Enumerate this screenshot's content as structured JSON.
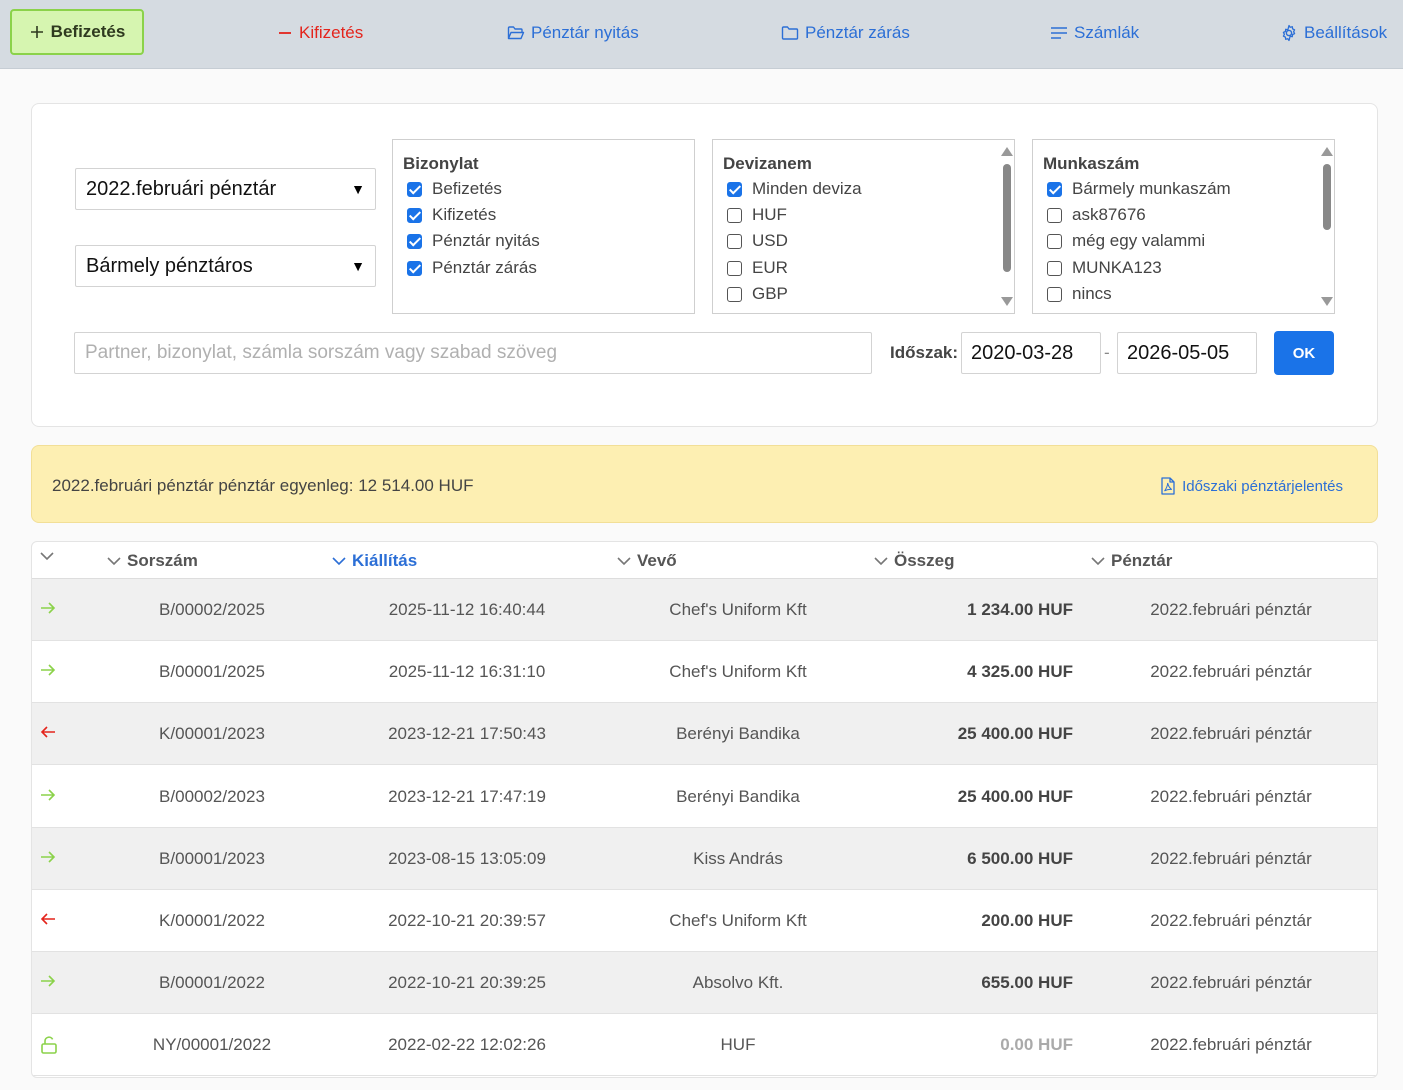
{
  "nav": {
    "deposit": "Befizetés",
    "withdrawal": "Kifizetés",
    "open_register": "Pénztár nyitás",
    "close_register": "Pénztár zárás",
    "invoices": "Számlák",
    "settings": "Beállítások"
  },
  "filters": {
    "register_select": "2022.februári pénztár",
    "cashier_select": "Bármely pénztáros",
    "document": {
      "title": "Bizonylat",
      "options": [
        "Befizetés",
        "Kifizetés",
        "Pénztár nyitás",
        "Pénztár zárás"
      ]
    },
    "currency": {
      "title": "Devizanem",
      "options": [
        "Minden deviza",
        "HUF",
        "USD",
        "EUR",
        "GBP"
      ]
    },
    "jobnumber": {
      "title": "Munkaszám",
      "options": [
        "Bármely munkaszám",
        "ask87676",
        "még egy valammi",
        "MUNKA123",
        "nincs"
      ]
    },
    "search_placeholder": "Partner, bizonylat, számla sorszám vagy szabad szöveg",
    "period_label": "Időszak:",
    "date_from": "2020-03-28",
    "date_to": "2026-05-05",
    "date_sep": "-",
    "ok": "OK"
  },
  "balance": {
    "text": "2022.februári pénztár pénztár egyenleg: 12 514.00 HUF",
    "report_link": "Időszaki pénztárjelentés"
  },
  "colors": {
    "accent": "#1a73e8",
    "deposit_arrow": "#8bd24a",
    "withdraw_arrow": "#e4241c",
    "balance_bg": "#fdefb2"
  },
  "table": {
    "headers": {
      "number": "Sorszám",
      "issued": "Kiállítás",
      "buyer": "Vevő",
      "amount": "Összeg",
      "register": "Pénztár"
    },
    "rows": [
      {
        "icon": "arrow-right-icon",
        "number": "B/00002/2025",
        "issued": "2025-11-12 16:40:44",
        "buyer": "Chef's Uniform Kft",
        "amount": "1 234.00 HUF",
        "register": "2022.februári pénztár"
      },
      {
        "icon": "arrow-right-icon",
        "number": "B/00001/2025",
        "issued": "2025-11-12 16:31:10",
        "buyer": "Chef's Uniform Kft",
        "amount": "4 325.00 HUF",
        "register": "2022.februári pénztár"
      },
      {
        "icon": "arrow-left-icon",
        "number": "K/00001/2023",
        "issued": "2023-12-21 17:50:43",
        "buyer": "Berényi Bandika",
        "amount": "25 400.00 HUF",
        "register": "2022.februári pénztár"
      },
      {
        "icon": "arrow-right-icon",
        "number": "B/00002/2023",
        "issued": "2023-12-21 17:47:19",
        "buyer": "Berényi Bandika",
        "amount": "25 400.00 HUF",
        "register": "2022.februári pénztár"
      },
      {
        "icon": "arrow-right-icon",
        "number": "B/00001/2023",
        "issued": "2023-08-15 13:05:09",
        "buyer": "Kiss András",
        "amount": "6 500.00 HUF",
        "register": "2022.februári pénztár"
      },
      {
        "icon": "arrow-left-icon",
        "number": "K/00001/2022",
        "issued": "2022-10-21 20:39:57",
        "buyer": "Chef's Uniform Kft",
        "amount": "200.00 HUF",
        "register": "2022.februári pénztár"
      },
      {
        "icon": "arrow-right-icon",
        "number": "B/00001/2022",
        "issued": "2022-10-21 20:39:25",
        "buyer": "Absolvo Kft.",
        "amount": "655.00 HUF",
        "register": "2022.februári pénztár"
      },
      {
        "icon": "lock-open-icon",
        "number": "NY/00001/2022",
        "issued": "2022-02-22 12:02:26",
        "buyer": "HUF",
        "amount": "0.00 HUF",
        "register": "2022.februári pénztár"
      }
    ]
  }
}
